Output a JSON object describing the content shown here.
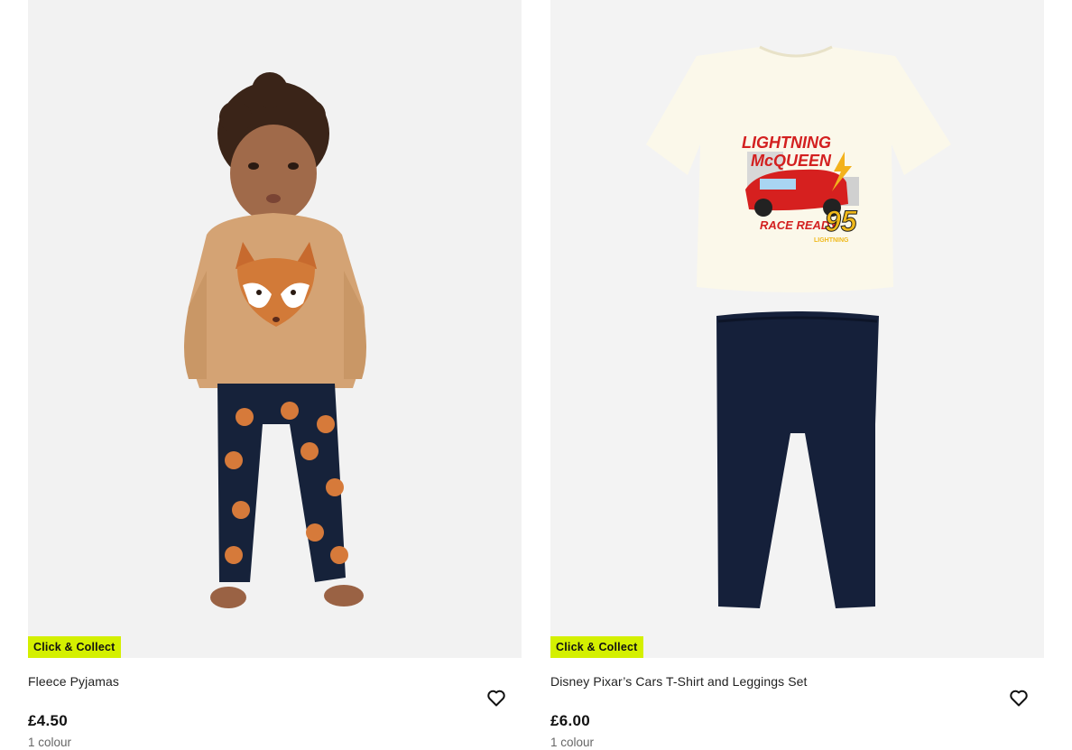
{
  "products": [
    {
      "badge": "Click & Collect",
      "title": "Fleece Pyjamas",
      "price": "£4.50",
      "colours": "1 colour",
      "image_alt": "Toddler wearing fox fleece pyjamas",
      "favourite_icon": "heart-outline-icon"
    },
    {
      "badge": "Click & Collect",
      "title": "Disney Pixar’s Cars T-Shirt and Leggings Set",
      "price": "£6.00",
      "colours": "1 colour",
      "image_alt": "Lightning McQueen t-shirt with navy leggings",
      "favourite_icon": "heart-outline-icon",
      "tshirt_print": {
        "line1": "LIGHTNING",
        "line2": "McQUEEN",
        "race": "RACE READY",
        "number": "95",
        "small": "LIGHTNING"
      }
    }
  ],
  "colors": {
    "badge_bg": "#d4f000",
    "text": "#1f1f1f",
    "muted": "#666666"
  }
}
